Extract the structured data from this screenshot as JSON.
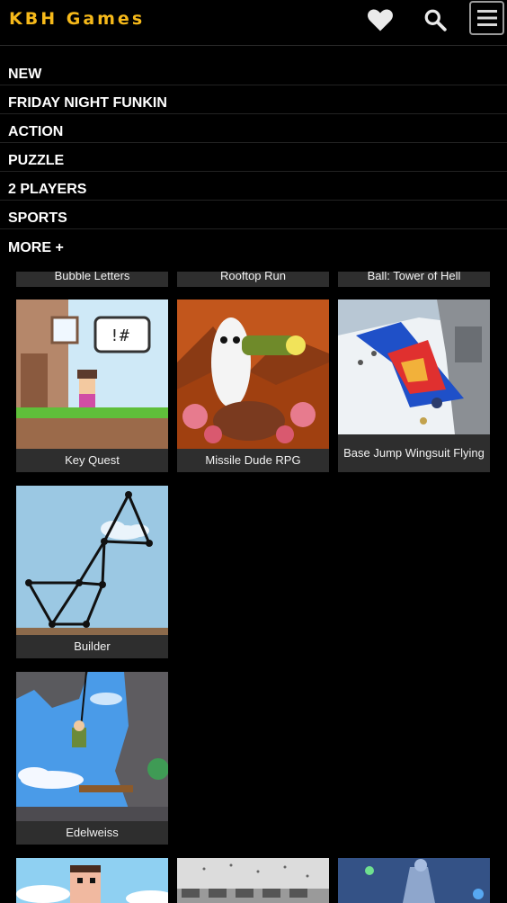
{
  "header": {
    "brand": "KBH Games",
    "favorites_icon": "heart-icon",
    "search_icon": "search-icon",
    "menu_icon": "hamburger-menu-icon"
  },
  "nav": {
    "items": [
      {
        "label": "NEW"
      },
      {
        "label": "FRIDAY NIGHT FUNKIN"
      },
      {
        "label": "ACTION"
      },
      {
        "label": "PUZZLE"
      },
      {
        "label": "2 PLAYERS"
      },
      {
        "label": "SPORTS"
      },
      {
        "label": "MORE +"
      }
    ]
  },
  "games": [
    {
      "title": "Bubble Letters"
    },
    {
      "title": "Rooftop Run"
    },
    {
      "title": "Ball: Tower of Hell"
    },
    {
      "title": "Key Quest"
    },
    {
      "title": "Missile Dude RPG"
    },
    {
      "title": "Base Jump Wingsuit Flying"
    },
    {
      "title": "Builder"
    },
    {
      "title": "Edelweiss"
    }
  ],
  "colors": {
    "brand": "#f6b91a",
    "background": "#000000",
    "card": "#2e2e2e",
    "text": "#ffffff"
  }
}
